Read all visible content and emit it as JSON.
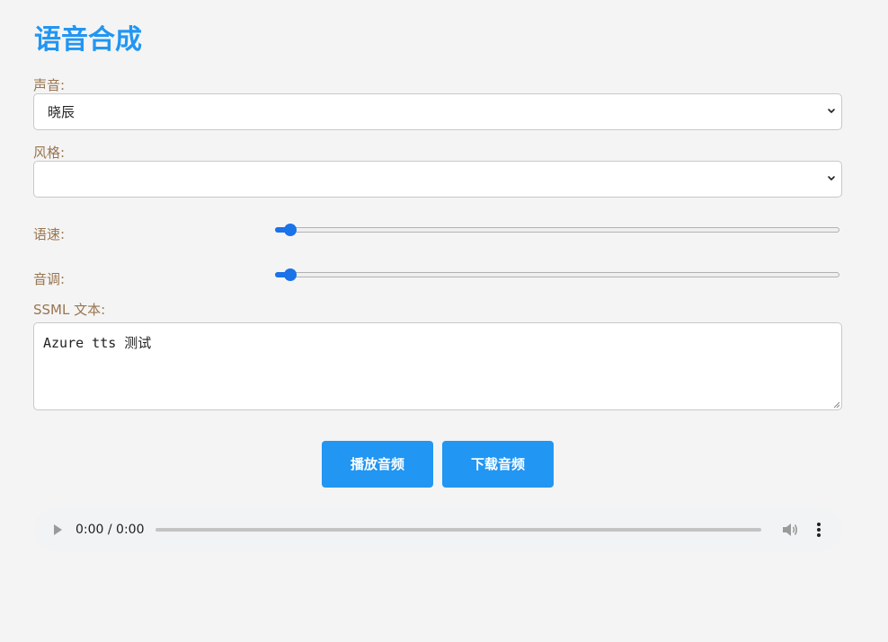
{
  "title": "语音合成",
  "voice": {
    "label": "声音:",
    "selected": "晓辰"
  },
  "style": {
    "label": "风格:",
    "selected": ""
  },
  "rate": {
    "label": "语速:",
    "value_fraction": 0.0
  },
  "pitch": {
    "label": "音调:",
    "value_fraction": 0.0
  },
  "ssml": {
    "label": "SSML 文本:",
    "value": "Azure tts 测试"
  },
  "buttons": {
    "play": "播放音频",
    "download": "下载音频"
  },
  "audio": {
    "time": "0:00 / 0:00",
    "progress_fraction": 0.0
  },
  "colors": {
    "accent": "#2196f3",
    "label": "#9a7550",
    "slider": "#1a73e8"
  },
  "icons": {
    "play": "play-icon",
    "volume": "volume-icon",
    "more": "more-vertical-icon",
    "select_arrow": "chevron-down-icon"
  }
}
